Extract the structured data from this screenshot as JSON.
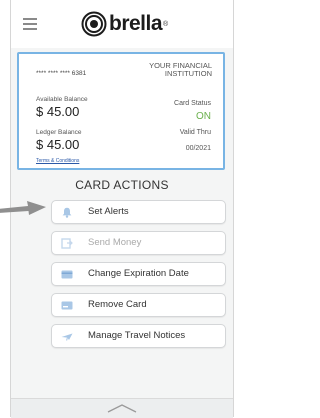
{
  "app": {
    "name": "brella",
    "trademark": "®"
  },
  "card": {
    "number": "**** **** **** 6381",
    "institution": "YOUR FINANCIAL INSTITUTION",
    "available_label": "Available Balance",
    "available_amount": "$ 45.00",
    "status_label": "Card Status",
    "status_value": "ON",
    "ledger_label": "Ledger Balance",
    "ledger_amount": "$ 45.00",
    "valid_label": "Valid Thru",
    "valid_value": "00/2021",
    "terms_link": "Terms & Conditions"
  },
  "actions": {
    "title": "CARD ACTIONS",
    "items": [
      {
        "label": "Set Alerts",
        "icon": "bell-icon",
        "enabled": true
      },
      {
        "label": "Send Money",
        "icon": "send-money-icon",
        "enabled": false
      },
      {
        "label": "Change Expiration Date",
        "icon": "card-icon",
        "enabled": true
      },
      {
        "label": "Remove Card",
        "icon": "remove-card-icon",
        "enabled": true
      },
      {
        "label": "Manage Travel Notices",
        "icon": "plane-icon",
        "enabled": true
      }
    ]
  },
  "colors": {
    "accent": "#78b4e4",
    "status_on": "#6ab04c",
    "icon": "#a9c7e6",
    "pointer_arrow": "#8f8f8f"
  }
}
